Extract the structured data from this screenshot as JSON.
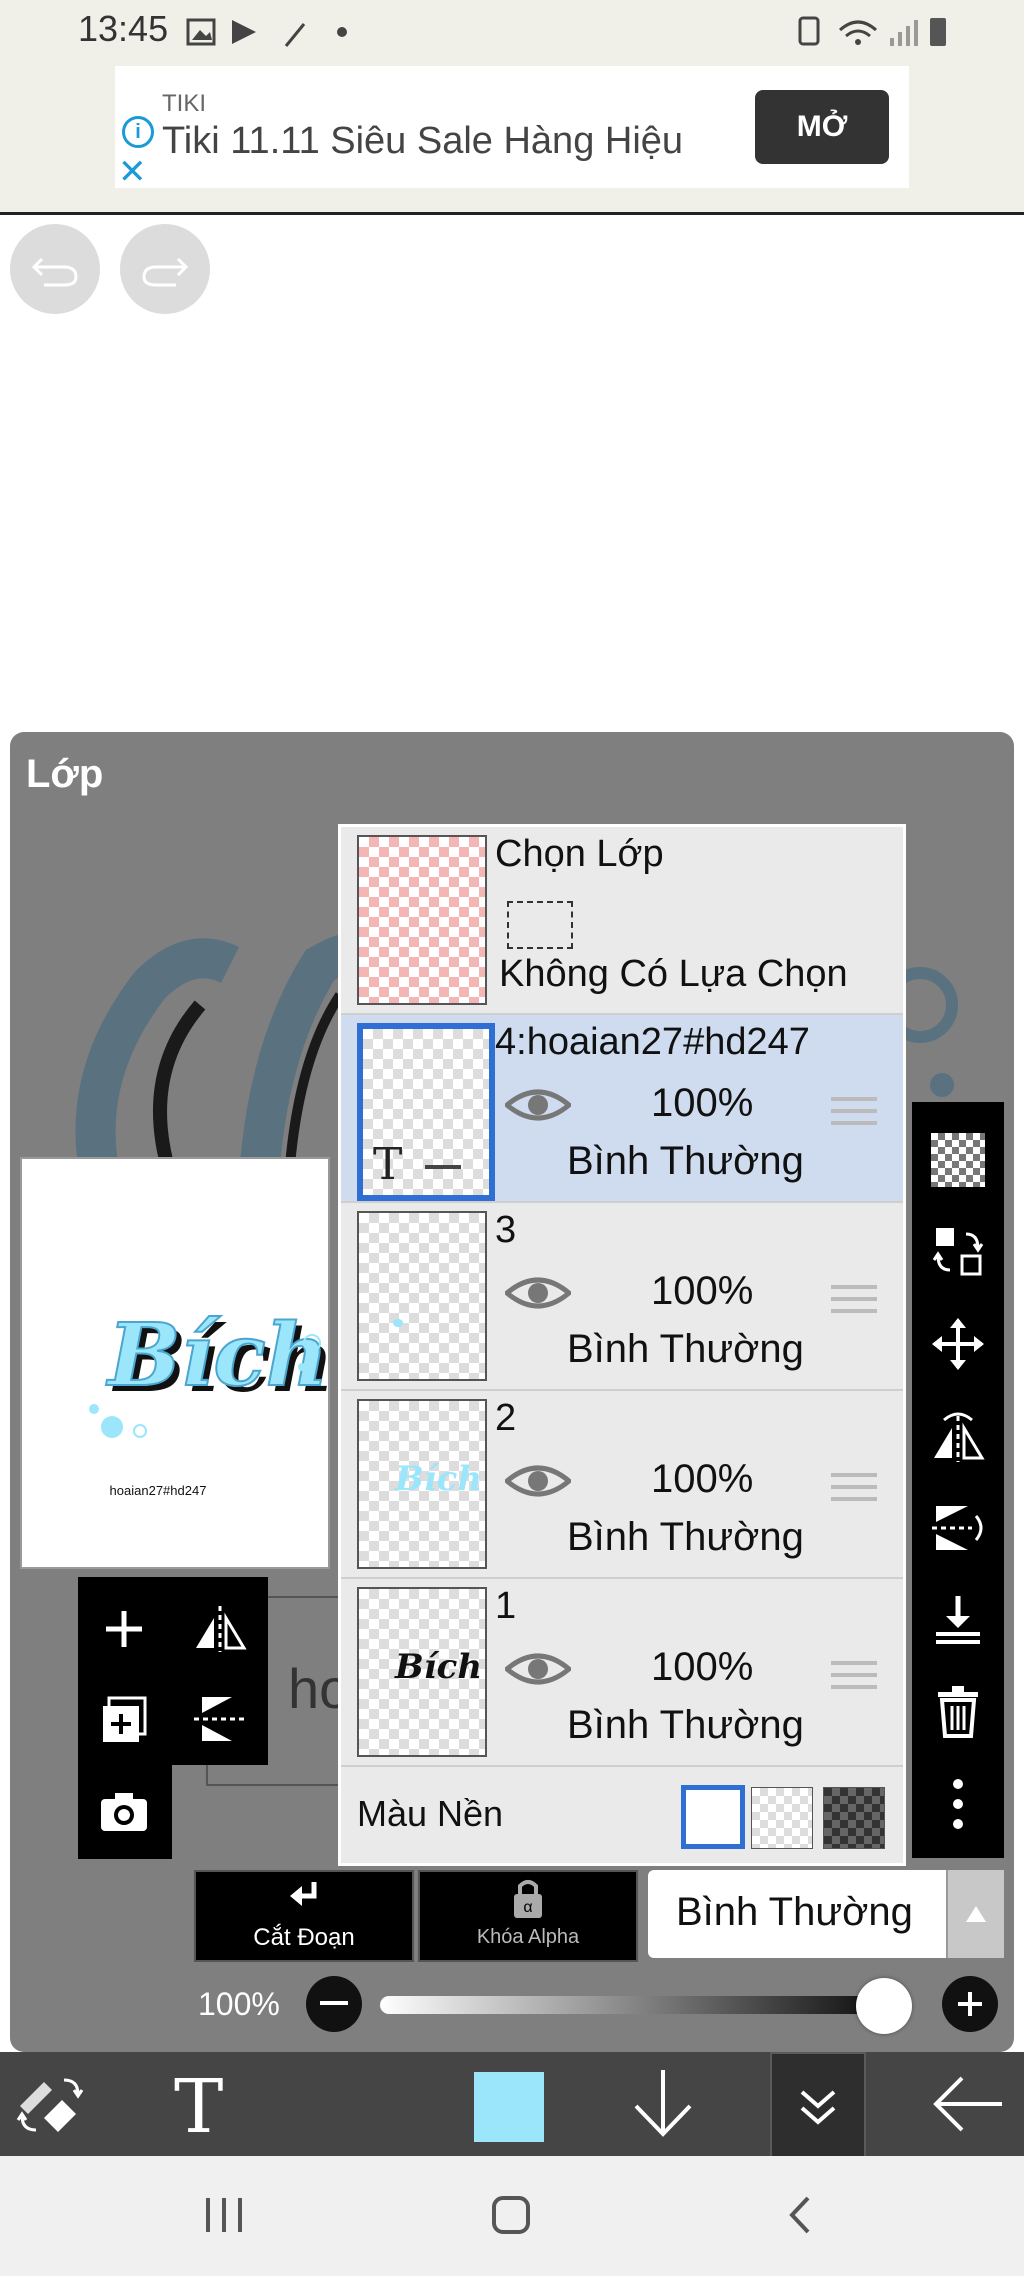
{
  "status_bar": {
    "time": "13:45"
  },
  "ad": {
    "tag": "TIKI",
    "title": "Tiki 11.11 Siêu Sale Hàng Hiệu",
    "info_glyph": "i",
    "close_glyph": "✕",
    "open_button": "MỞ"
  },
  "panel": {
    "title": "Lớp",
    "canvas_preview": {
      "art_text": "Bích",
      "caption": "hoaian27#hd247"
    },
    "partial_text": "ho"
  },
  "selection_row": {
    "title": "Chọn Lớp",
    "subtitle": "Không Có Lựa Chọn"
  },
  "layers": [
    {
      "name": "4:hoaian27#hd247",
      "opacity": "100%",
      "blend": "Bình Thường",
      "selected": true,
      "thumb_glyph": "T"
    },
    {
      "name": "3",
      "opacity": "100%",
      "blend": "Bình Thường",
      "selected": false
    },
    {
      "name": "2",
      "opacity": "100%",
      "blend": "Bình Thường",
      "selected": false,
      "thumb_text": "Bích"
    },
    {
      "name": "1",
      "opacity": "100%",
      "blend": "Bình Thường",
      "selected": false,
      "thumb_text": "Bích"
    }
  ],
  "background_row": {
    "label": "Màu Nền"
  },
  "bottom_controls": {
    "cut_label": "Cắt Đoạn",
    "alpha_lock_label": "Khóa Alpha",
    "blend_mode": "Bình Thường",
    "opacity_label": "100%",
    "opacity_value": 0.95
  },
  "colors": {
    "accent_blue": "#2f6fd3",
    "current_color": "#9be6fb",
    "panel_gray": "#7f7f7f"
  }
}
